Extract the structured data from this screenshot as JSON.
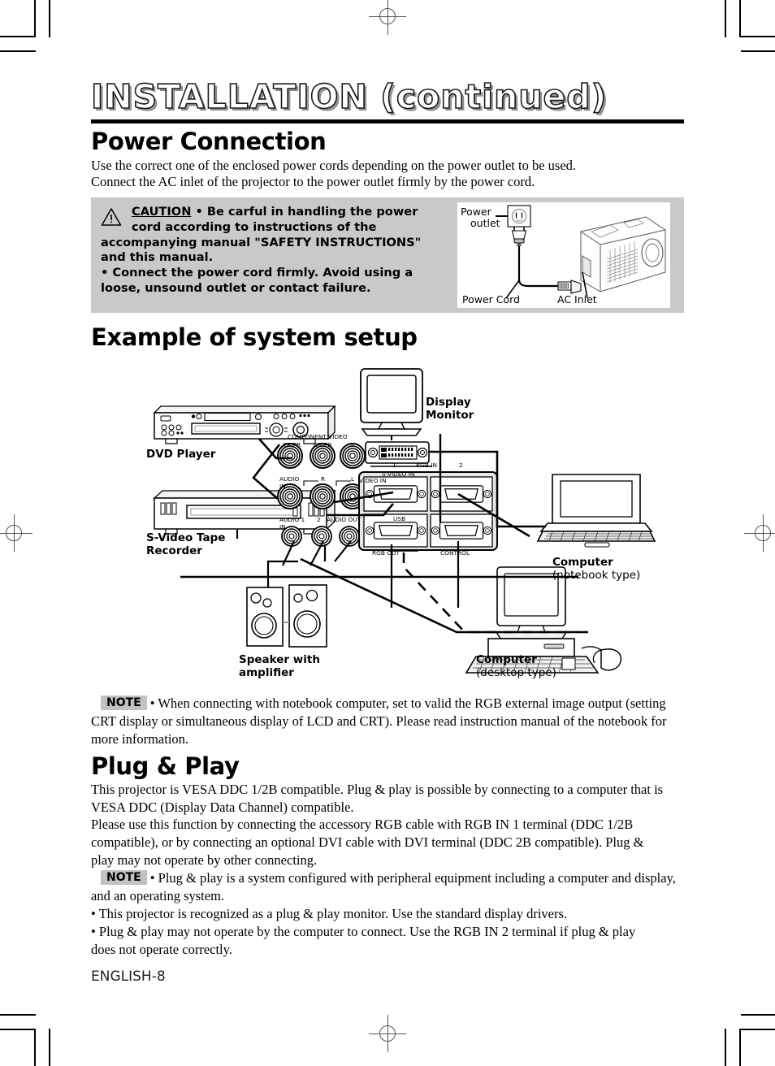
{
  "document": {
    "title": "INSTALLATION (continued)",
    "footer": "ENGLISH-8"
  },
  "power_connection": {
    "heading": "Power Connection",
    "paragraph_line1": "Use the correct one of the enclosed power cords depending on the power outlet to be used.",
    "paragraph_line2": "Connect the AC inlet of the projector to the power outlet firmly by the power cord."
  },
  "caution": {
    "label": "CAUTION",
    "line1": "• Be carful in handling the power",
    "line2": "cord according to instructions of the",
    "line3": "accompanying manual \"SAFETY INSTRUCTIONS\"",
    "line4": "and this manual.",
    "line5": "• Connect the power cord firmly. Avoid using a",
    "line6": "loose, unsound outlet or contact failure.",
    "illustration": {
      "power_outlet_line1": "Power",
      "power_outlet_line2": "outlet",
      "power_cord": "Power Cord",
      "ac_inlet": "AC Inlet"
    }
  },
  "system_setup": {
    "heading": "Example of system setup",
    "devices": {
      "dvd_player": "DVD Player",
      "svideo_recorder_line1": "S-Video Tape",
      "svideo_recorder_line2": "Recorder",
      "display_monitor_line1": "Display",
      "display_monitor_line2": "Monitor",
      "speaker_line1": "Speaker with",
      "speaker_line2": "amplifier",
      "computer_notebook_line1": "Computer",
      "computer_notebook_line2": "(notebook type)",
      "computer_desktop_line1": "Computer",
      "computer_desktop_line2": "(desktop type)"
    },
    "terminal_labels": {
      "component_video": "COMPONENT VIDEO",
      "cr_pr": "CR/PR",
      "cb_pb": "CB/PB",
      "y": "Y",
      "audio": "AUDIO",
      "in": "IN",
      "r": "R",
      "l": "L",
      "video_in": "VIDEO IN",
      "svideo_in": "S-VIDEO IN",
      "audio1": "AUDIO 1",
      "audio1_in": "IN",
      "audio2": "2",
      "audio_out": "AUDIO OUT",
      "usb": "USB",
      "rgb_in": "RGB  IN",
      "rgb_in_1": "1",
      "rgb_in_2": "2",
      "rgb_out": "RGB  OUT",
      "control": "CONTROL"
    }
  },
  "note1": {
    "badge": "NOTE",
    "text": "• When connecting with notebook computer, set to valid the RGB external image output (setting CRT display or simultaneous display of LCD and CRT). Please read instruction manual of the notebook for more information."
  },
  "plug_and_play": {
    "heading": "Plug & Play",
    "paragraph1": "This projector is VESA DDC 1/2B compatible. Plug & play is possible by connecting to a computer that is VESA DDC (Display Data Channel) compatible.",
    "paragraph2": "Please use this function by connecting the accessory RGB cable with RGB IN 1 terminal (DDC 1/2B compatible), or by connecting an optional DVI cable with DVI terminal (DDC 2B compatible). Plug & play may not operate by other connecting."
  },
  "note2": {
    "badge": "NOTE",
    "text1": "• Plug & play is a system configured with peripheral equipment including a computer and display, and an operating system.",
    "text2": "• This projector is recognized as a plug & play monitor. Use the standard display drivers.",
    "text3": "• Plug & play may not operate by the computer to connect. Use the RGB IN 2 terminal if plug & play does not operate correctly."
  },
  "colors": {
    "caution_background": "#c9c9c9",
    "note_badge_background": "#c2c2c2",
    "rule": "#000000"
  }
}
